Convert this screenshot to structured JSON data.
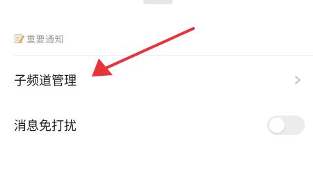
{
  "notice": {
    "label": "重要通知",
    "icon": "memo-icon"
  },
  "settings": {
    "items": [
      {
        "label": "子频道管理",
        "control": "chevron-right-icon"
      },
      {
        "label": "消息免打扰",
        "control": "toggle",
        "enabled": false
      }
    ]
  },
  "colors": {
    "annotation_arrow": "#e8333a",
    "toggle_off": "#ececec",
    "secondary_text": "#9a9a9a",
    "primary_text": "#1f1f1f"
  }
}
